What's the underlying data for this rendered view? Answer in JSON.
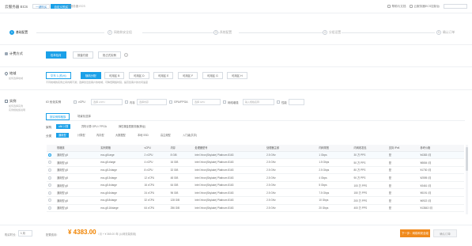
{
  "header": {
    "brand": "云服务器 ECS",
    "mode_tabs": [
      "一键购买",
      "自定义购买"
    ],
    "region_text": "云服务器 ECS",
    "links": [
      "帮助与文档",
      "云服务器ECS控制台",
      "云服务器 ECS"
    ]
  },
  "steps": [
    {
      "num": "1",
      "label": "基础配置"
    },
    {
      "num": "2",
      "label": "网络和安全组"
    },
    {
      "num": "3",
      "label": "系统配置"
    },
    {
      "num": "4",
      "label": "分组设置"
    },
    {
      "num": "5",
      "label": "确认订单"
    }
  ],
  "billing": {
    "label": "计费方式",
    "options": [
      "包年包月",
      "按量付费",
      "抢占式实例"
    ],
    "selected": "包年包月"
  },
  "region": {
    "label": "地域",
    "sublabel": "如何选择地域",
    "options": [
      "华东 1 (杭州)",
      "随机分配",
      "可用区 B",
      "可用区 D",
      "可用区 E",
      "可用区 F",
      "可用区 G",
      "可用区 H"
    ],
    "selected": "随机分配",
    "note": "不同地域的实例之间内网不通；选择靠近您客户的地域，可降低网络时延，提高您客户的访问速度"
  },
  "instance": {
    "label": "实例",
    "sublabels": [
      "如何选择实例",
      "实例规格族说明"
    ],
    "filters": {
      "vcpu_label": "vCPU",
      "vcpu_placeholder": "选择 vCPU",
      "mem_label": "内存",
      "mem_placeholder": "选择内存",
      "gpu_label": "GPU/FPGA",
      "gpu_placeholder": "选择 GPU",
      "net_label": "网络增强",
      "spec_placeholder": "输入规格名称",
      "perf_label": "性能",
      "count_label": "IO 优化实例"
    },
    "tabs": [
      "按实例规格族",
      "场景化选择"
    ],
    "arch_label": "架构",
    "archs": [
      "x86 计算",
      "异构计算 GPU / FPGA",
      "弹性裸金属服务器(神龙)"
    ],
    "category_label": "分类",
    "categories": [
      "通用型",
      "计算型",
      "内存型",
      "大数据型",
      "本地 SSD",
      "高主频型",
      "入门级(共享)"
    ],
    "selected_category": "通用型"
  },
  "table": {
    "columns": [
      "规格族",
      "实例规格",
      "vCPU",
      "内存",
      "处理器型号",
      "处理器主频",
      "内网带宽",
      "内网收发包",
      "支持 IPv6",
      "参考价格"
    ],
    "rows": [
      [
        "通用型 g5",
        "ecs.g5.large",
        "2 vCPU",
        "8 GiB",
        "Intel Xeon(Skylake) Platinum 8163",
        "2.5 GHz",
        "1 Gbps",
        "30 万 PPS",
        "是",
        "¥4383 /月"
      ],
      [
        "通用型 g5",
        "ecs.g5.xlarge",
        "4 vCPU",
        "16 GiB",
        "Intel Xeon(Skylake) Platinum 8163",
        "2.5 GHz",
        "1.5 Gbps",
        "50 万 PPS",
        "是",
        "¥8654 /月"
      ],
      [
        "通用型 g5",
        "ecs.g5.2xlarge",
        "8 vCPU",
        "32 GiB",
        "Intel Xeon(Skylake) Platinum 8163",
        "2.5 GHz",
        "2.5 Gbps",
        "80 万 PPS",
        "是",
        "¥1730 /月"
      ],
      [
        "通用型 g5",
        "ecs.g5.3xlarge",
        "12 vCPU",
        "48 GiB",
        "Intel Xeon(Skylake) Platinum 8163",
        "2.5 GHz",
        "4 Gbps",
        "90 万 PPS",
        "是",
        "¥2595 /月"
      ],
      [
        "通用型 g5",
        "ecs.g5.4xlarge",
        "16 vCPU",
        "64 GiB",
        "Intel Xeon(Skylake) Platinum 8163",
        "2.5 GHz",
        "5 Gbps",
        "100 万 PPS",
        "是",
        "¥3461 /月"
      ],
      [
        "通用型 g5",
        "ecs.g5.6xlarge",
        "24 vCPU",
        "96 GiB",
        "Intel Xeon(Skylake) Platinum 8163",
        "2.5 GHz",
        "7.5 Gbps",
        "150 万 PPS",
        "是",
        "¥5191 /月"
      ],
      [
        "通用型 g5",
        "ecs.g5.8xlarge",
        "32 vCPU",
        "128 GiB",
        "Intel Xeon(Skylake) Platinum 8163",
        "2.5 GHz",
        "10 Gbps",
        "200 万 PPS",
        "是",
        "¥6922 /月"
      ],
      [
        "通用型 g5",
        "ecs.g5.16xlarge",
        "64 vCPU",
        "256 GiB",
        "Intel Xeon(Skylake) Platinum 8163",
        "2.5 GHz",
        "20 Gbps",
        "400 万 PPS",
        "是",
        "¥13843 /月"
      ]
    ],
    "selected_row": 0
  },
  "footer": {
    "duration_label": "购买时长:",
    "duration_value": "1 月",
    "cost_label": "配置费用:",
    "price": "¥ 4383.00",
    "price_sub": "/ 月 + ¥ 365.00 /年 (公网流量费用)",
    "next_button": "下一步：网络和安全组",
    "quote_button": "确认订单"
  },
  "colors": {
    "accent": "#1aa0e8",
    "price": "#f08300",
    "next_button": "#f08a1c"
  }
}
